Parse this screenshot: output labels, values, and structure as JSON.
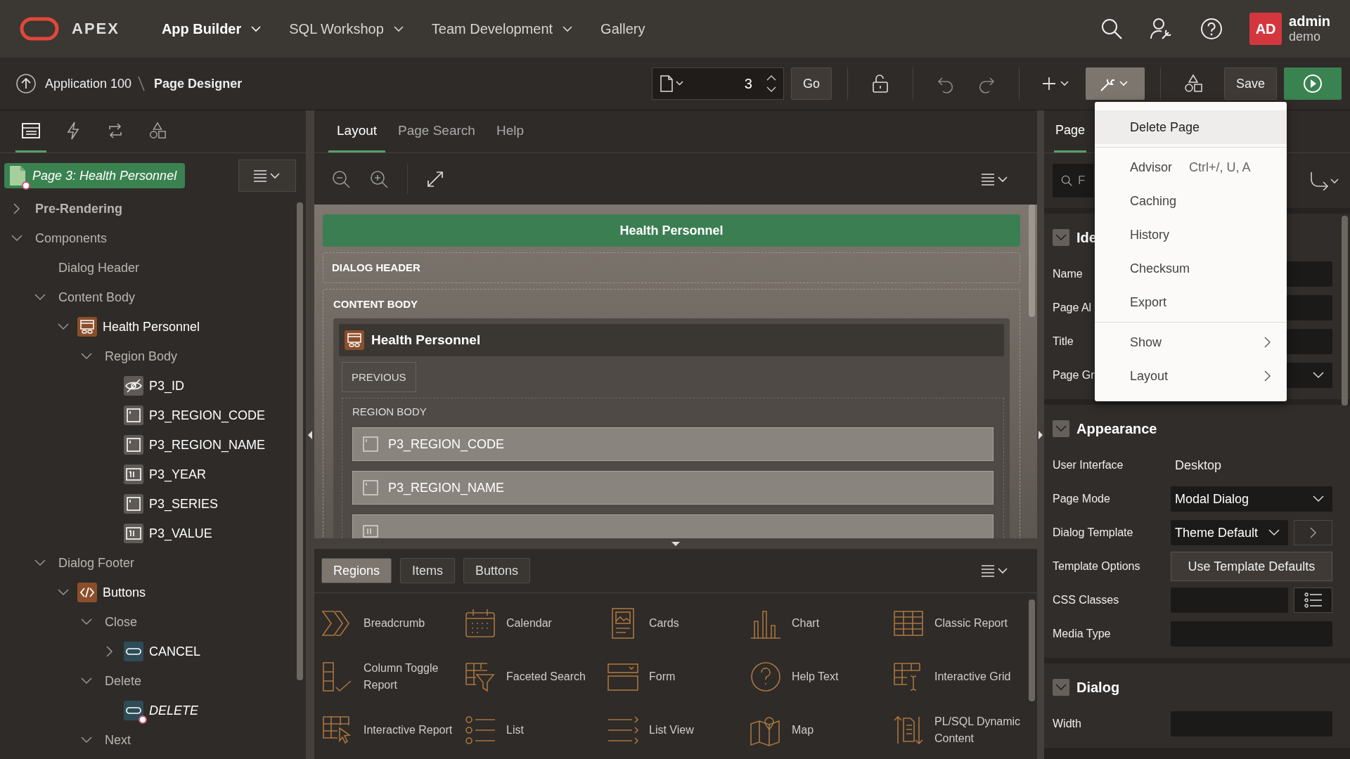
{
  "header": {
    "logo_text": "APEX",
    "nav": [
      {
        "label": "App Builder",
        "selected": true,
        "dropdown": true
      },
      {
        "label": "SQL Workshop",
        "selected": false,
        "dropdown": true
      },
      {
        "label": "Team Development",
        "selected": false,
        "dropdown": true
      },
      {
        "label": "Gallery",
        "selected": false,
        "dropdown": false
      }
    ],
    "user": {
      "initials": "AD",
      "name": "admin",
      "workspace": "demo"
    }
  },
  "toolbar": {
    "breadcrumb": [
      "Application 100",
      "Page Designer"
    ],
    "page_number": "3",
    "go_label": "Go",
    "utilities_open": true,
    "save_label": "Save"
  },
  "left_panel": {
    "tabs": [
      {
        "kind": "rendering",
        "selected": true
      },
      {
        "kind": "dynamic-actions",
        "selected": false
      },
      {
        "kind": "processing",
        "selected": false
      },
      {
        "kind": "shared-components",
        "selected": false
      }
    ],
    "root": {
      "label": "Page 3: Health Personnel",
      "flagged": true
    },
    "tree": [
      {
        "label": "Pre-Rendering",
        "kind": "section",
        "expanded": false
      },
      {
        "label": "Components",
        "kind": "folder",
        "expanded": true,
        "children": [
          {
            "label": "Dialog Header",
            "kind": "folder"
          },
          {
            "label": "Content Body",
            "kind": "folder",
            "expanded": true,
            "children": [
              {
                "label": "Health Personnel",
                "kind": "region",
                "expanded": true,
                "children": [
                  {
                    "label": "Region Body",
                    "kind": "folder",
                    "expanded": true,
                    "children": [
                      {
                        "label": "P3_ID",
                        "kind": "hidden-item"
                      },
                      {
                        "label": "P3_REGION_CODE",
                        "kind": "text-item"
                      },
                      {
                        "label": "P3_REGION_NAME",
                        "kind": "text-item"
                      },
                      {
                        "label": "P3_YEAR",
                        "kind": "number-item"
                      },
                      {
                        "label": "P3_SERIES",
                        "kind": "text-item"
                      },
                      {
                        "label": "P3_VALUE",
                        "kind": "number-item"
                      }
                    ]
                  }
                ]
              }
            ]
          },
          {
            "label": "Dialog Footer",
            "kind": "folder",
            "expanded": true,
            "children": [
              {
                "label": "Buttons",
                "kind": "code-region",
                "expanded": true,
                "children": [
                  {
                    "label": "Close",
                    "kind": "folder",
                    "expanded": true,
                    "children": [
                      {
                        "label": "CANCEL",
                        "kind": "button",
                        "expanded": false,
                        "flagged": false
                      }
                    ]
                  },
                  {
                    "label": "Delete",
                    "kind": "folder",
                    "expanded": true,
                    "children": [
                      {
                        "label": "DELETE",
                        "kind": "button",
                        "flagged": true
                      }
                    ]
                  },
                  {
                    "label": "Next",
                    "kind": "folder",
                    "expanded": true
                  }
                ]
              }
            ]
          }
        ]
      }
    ]
  },
  "center": {
    "tabs": [
      {
        "label": "Layout",
        "selected": true
      },
      {
        "label": "Page Search",
        "selected": false
      },
      {
        "label": "Help",
        "selected": false
      }
    ],
    "canvas": {
      "title": "Health Personnel",
      "dialog_header": "DIALOG HEADER",
      "content_body": "CONTENT BODY",
      "region": {
        "title": "Health Personnel",
        "slot": "PREVIOUS",
        "body_label": "REGION BODY",
        "items": [
          {
            "label": "P3_REGION_CODE",
            "kind": "text-item"
          },
          {
            "label": "P3_REGION_NAME",
            "kind": "text-item"
          },
          {
            "kind": "number-item"
          }
        ]
      }
    },
    "gallery": {
      "tabs": [
        {
          "label": "Regions",
          "selected": true
        },
        {
          "label": "Items",
          "selected": false
        },
        {
          "label": "Buttons",
          "selected": false
        }
      ],
      "items": [
        {
          "label": "Breadcrumb",
          "kind": "breadcrumb"
        },
        {
          "label": "Calendar",
          "kind": "calendar"
        },
        {
          "label": "Cards",
          "kind": "cards"
        },
        {
          "label": "Chart",
          "kind": "chart"
        },
        {
          "label": "Classic Report",
          "kind": "classic-report"
        },
        {
          "label": "Column Toggle Report",
          "kind": "column-toggle"
        },
        {
          "label": "Faceted Search",
          "kind": "faceted-search"
        },
        {
          "label": "Form",
          "kind": "form"
        },
        {
          "label": "Help Text",
          "kind": "help"
        },
        {
          "label": "Interactive Grid",
          "kind": "interactive-grid"
        },
        {
          "label": "Interactive Report",
          "kind": "interactive-report"
        },
        {
          "label": "List",
          "kind": "list"
        },
        {
          "label": "List View",
          "kind": "list-view"
        },
        {
          "label": "Map",
          "kind": "map"
        },
        {
          "label": "PL/SQL Dynamic Content",
          "kind": "plsql"
        }
      ]
    }
  },
  "right_panel": {
    "tab": {
      "label": "Page",
      "selected": true
    },
    "search": {
      "placeholder": "F"
    },
    "groups": [
      {
        "title": "Ide",
        "expanded": true,
        "rows": [
          {
            "label": "Name",
            "kind": "field"
          },
          {
            "label": "Page Al",
            "kind": "field"
          },
          {
            "label": "Title",
            "kind": "field"
          },
          {
            "label": "Page Gr",
            "kind": "select"
          }
        ]
      },
      {
        "title": "Appearance",
        "expanded": true,
        "rows": [
          {
            "label": "User Interface",
            "kind": "text",
            "value": "Desktop"
          },
          {
            "label": "Page Mode",
            "kind": "select",
            "value": "Modal Dialog"
          },
          {
            "label": "Dialog Template",
            "kind": "select-link",
            "value": "Theme Default"
          },
          {
            "label": "Template Options",
            "kind": "button",
            "value": "Use Template Defaults"
          },
          {
            "label": "CSS Classes",
            "kind": "field-list"
          },
          {
            "label": "Media Type",
            "kind": "field"
          }
        ]
      },
      {
        "title": "Dialog",
        "expanded": true,
        "rows": [
          {
            "label": "Width",
            "kind": "field"
          }
        ]
      }
    ]
  },
  "utilities_menu": {
    "groups": [
      [
        {
          "label": "Delete Page",
          "selected": true,
          "submenu": false
        }
      ],
      [
        {
          "label": "Advisor",
          "shortcut": "Ctrl+/, U, A",
          "selected": false,
          "submenu": false
        },
        {
          "label": "Caching",
          "selected": false,
          "submenu": false
        },
        {
          "label": "History",
          "selected": false,
          "submenu": false
        },
        {
          "label": "Checksum",
          "selected": false,
          "submenu": false
        },
        {
          "label": "Export",
          "selected": false,
          "submenu": false
        }
      ],
      [
        {
          "label": "Show",
          "selected": false,
          "submenu": true
        },
        {
          "label": "Layout",
          "selected": false,
          "submenu": true
        }
      ]
    ]
  }
}
